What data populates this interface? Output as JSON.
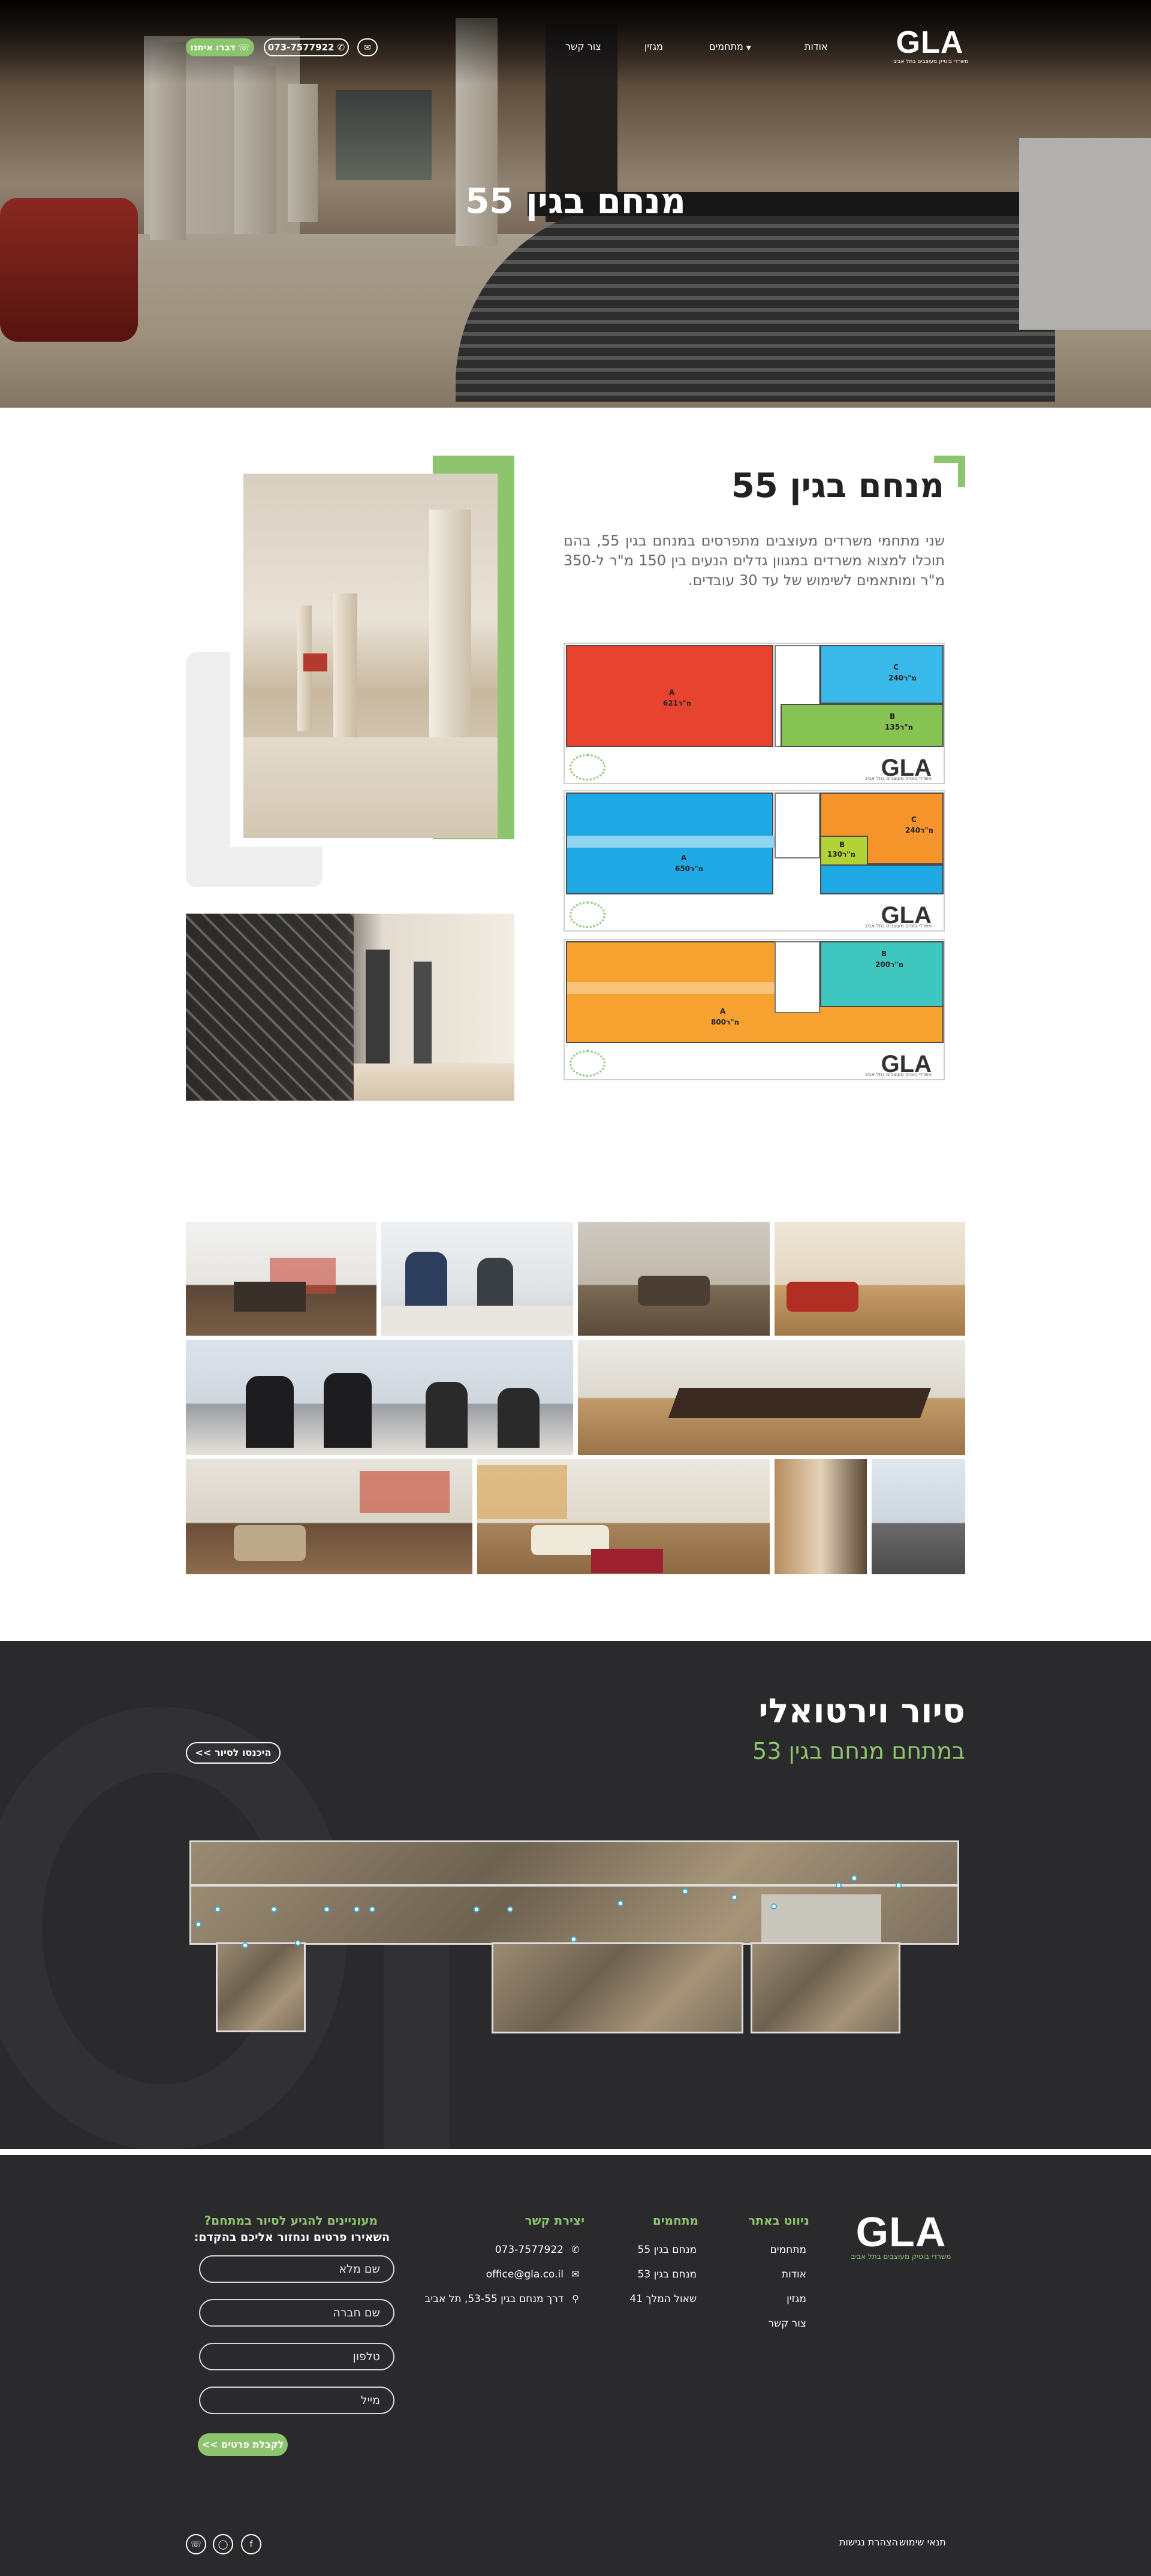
{
  "header": {
    "logo_text": "GLA",
    "logo_tagline": "משרדי בוטיק מעוצבים בתל אביב",
    "nav": {
      "about": "אודות",
      "complexes": "מתחמים",
      "magazine": "מגזין",
      "contact": "צור קשר"
    },
    "phone_label": "073-7577922",
    "whatsapp_label": "דברו איתנו"
  },
  "hero": {
    "title": "מנחם בגין 55"
  },
  "intro": {
    "title": "מנחם בגין 55",
    "paragraph": "שני מתחמי משרדים מעוצבים מתפרסים במנחם בגין 55, בהם תוכלו למצוא משרדים במגוון גדלים הנעים בין 150 מ\"ר ל-350 מ\"ר ומותאמים לשימוש של עד 30 עובדים."
  },
  "floorplans": [
    {
      "areas": [
        {
          "letter": "A",
          "size": "מ\"ר621"
        },
        {
          "letter": "C",
          "size": "מ\"ר240"
        },
        {
          "letter": "B",
          "size": "מ\"ר135"
        }
      ],
      "logo": "GLA",
      "logo_tag": "משרדי בוטיק מעוצבים בתל אביב"
    },
    {
      "areas": [
        {
          "letter": "A",
          "size": "מ\"ר650"
        },
        {
          "letter": "C",
          "size": "מ\"ר240"
        },
        {
          "letter": "B",
          "size": "מ\"ר130"
        }
      ],
      "logo": "GLA",
      "logo_tag": "משרדי בוטיק מעוצבים בתל אביב"
    },
    {
      "areas": [
        {
          "letter": "A",
          "size": "מ\"ר800"
        },
        {
          "letter": "B",
          "size": "מ\"ר200"
        }
      ],
      "logo": "GLA",
      "logo_tag": "משרדי בוטיק מעוצבים בתל אביב"
    }
  ],
  "virtual_tour": {
    "title": "סיור וירטואלי",
    "subtitle": "במתחם מנחם בגין 53",
    "button": "היכנסו לסיור >>"
  },
  "footer": {
    "logo_text": "GLA",
    "logo_tagline": "משרדי בוטיק מעוצבים בתל אביב",
    "nav_heading": "ניווט באתר",
    "nav_links": [
      "מתחמים",
      "אודות",
      "מגזין",
      "צור קשר"
    ],
    "complexes_heading": "מתחמים",
    "complexes_links": [
      "מנחם בגין 55",
      "מנחם בגין 53",
      "שאול המלך 41"
    ],
    "contact_heading": "יצירת קשר",
    "contact_phone": "073-7577922",
    "contact_email": "office@gla.co.il",
    "contact_address": "דרך מנחם בגין 53-55, תל אביב",
    "form_heading": "מעוניינים להגיע לסיור במתחם?",
    "form_subheading": "השאירו פרטים ונחזור אליכם בהקדם:",
    "form_fields": {
      "name": "שם מלא",
      "company": "שם חברה",
      "phone": "טלפון",
      "email": "מייל"
    },
    "form_submit": "לקבלת פרטים >>",
    "terms": "תנאי שימוש",
    "accessibility": "הצהרת נגישות",
    "social_icons": [
      "whatsapp-icon",
      "instagram-icon",
      "facebook-icon"
    ]
  },
  "colors": {
    "accent_green": "#8cc56d",
    "dark_bg": "#2a2a2c"
  }
}
